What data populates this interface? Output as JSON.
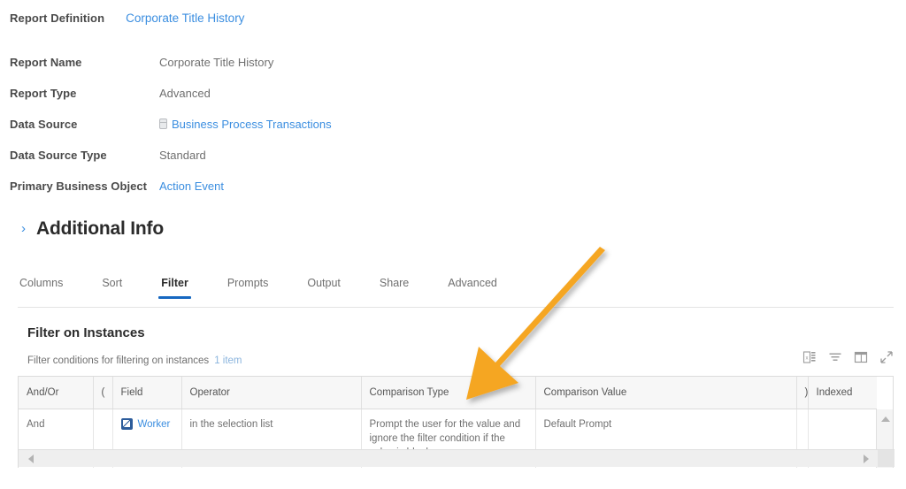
{
  "breadcrumb": {
    "label": "Report Definition",
    "link": "Corporate Title History"
  },
  "fields": [
    {
      "label": "Report Name",
      "value": "Corporate Title History",
      "type": "text"
    },
    {
      "label": "Report Type",
      "value": "Advanced",
      "type": "text"
    },
    {
      "label": "Data Source",
      "value": "Business Process Transactions",
      "type": "link-with-icon",
      "icon": "database-icon"
    },
    {
      "label": "Data Source Type",
      "value": "Standard",
      "type": "text"
    },
    {
      "label": "Primary Business Object",
      "value": "Action Event",
      "type": "link"
    }
  ],
  "additional_info": {
    "chevron": "chevron-right-icon",
    "title": "Additional Info"
  },
  "tabs": [
    {
      "label": "Columns",
      "active": false
    },
    {
      "label": "Sort",
      "active": false
    },
    {
      "label": "Filter",
      "active": true
    },
    {
      "label": "Prompts",
      "active": false
    },
    {
      "label": "Output",
      "active": false
    },
    {
      "label": "Share",
      "active": false
    },
    {
      "label": "Advanced",
      "active": false
    }
  ],
  "section": {
    "title": "Filter on Instances",
    "subtitle": "Filter conditions for filtering on instances",
    "count": "1 item"
  },
  "grid_tools": [
    {
      "name": "export-to-excel-icon"
    },
    {
      "name": "filter-icon"
    },
    {
      "name": "toggle-columns-icon"
    },
    {
      "name": "expand-icon"
    }
  ],
  "table": {
    "columns": [
      "And/Or",
      "(",
      "Field",
      "Operator",
      "Comparison Type",
      "Comparison Value",
      ")",
      "Indexed",
      ""
    ],
    "rows": [
      {
        "and_or": "And",
        "open_paren": "",
        "field": "Worker",
        "field_icon": "worker-badge-icon",
        "operator": "in the selection list",
        "comparison_type": "Prompt the user for the value and ignore the filter condition if the value is blank",
        "comparison_value": "Default Prompt",
        "close_paren": "",
        "indexed": "",
        "extra": ""
      }
    ]
  },
  "annotation": {
    "type": "arrow",
    "color": "#F5A623",
    "points_to": "Comparison Type column header"
  },
  "colors": {
    "link": "#3b8ee0",
    "tab_active_underline": "#1668c1",
    "arrow": "#F5A623",
    "header_bg": "#f7f7f7",
    "border": "#dcdcdc"
  }
}
